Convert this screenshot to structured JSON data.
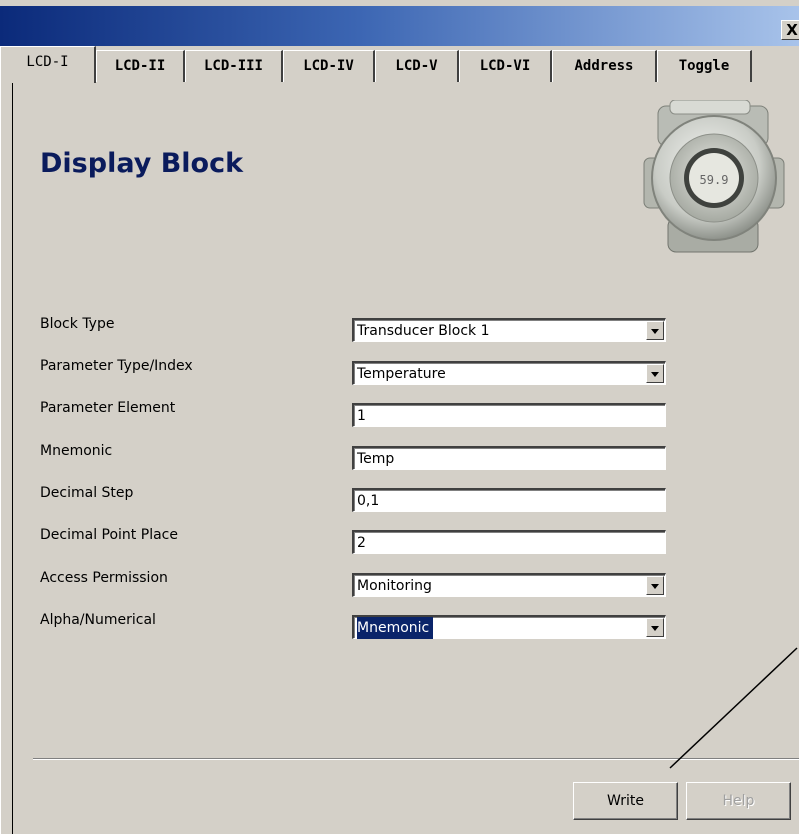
{
  "window": {
    "close_label": "X"
  },
  "tabs": [
    {
      "label": "LCD-I",
      "active": true
    },
    {
      "label": "LCD-II"
    },
    {
      "label": "LCD-III"
    },
    {
      "label": "LCD-IV"
    },
    {
      "label": "LCD-V"
    },
    {
      "label": "LCD-VI"
    },
    {
      "label": "Address"
    },
    {
      "label": "Toggle"
    }
  ],
  "heading": "Display Block",
  "device_image": {
    "display_text": "59.9",
    "icon": "transmitter-housing-icon"
  },
  "fields": {
    "block_type": {
      "label": "Block Type",
      "value": "Transducer Block 1",
      "kind": "dropdown"
    },
    "parameter_type_index": {
      "label": "Parameter Type/Index",
      "value": "Temperature",
      "kind": "dropdown"
    },
    "parameter_element": {
      "label": "Parameter Element",
      "value": "1",
      "kind": "text"
    },
    "mnemonic": {
      "label": "Mnemonic",
      "value": "Temp",
      "kind": "text"
    },
    "decimal_step": {
      "label": "Decimal Step",
      "value": "0,1",
      "kind": "text"
    },
    "decimal_point_place": {
      "label": "Decimal Point Place",
      "value": "2",
      "kind": "text"
    },
    "access_permission": {
      "label": "Access Permission",
      "value": "Monitoring",
      "kind": "dropdown"
    },
    "alpha_numerical": {
      "label": "Alpha/Numerical",
      "value": "Mnemonic",
      "kind": "dropdown",
      "selected": true
    }
  },
  "buttons": {
    "write": "Write",
    "help": "Help"
  },
  "colors": {
    "heading": "#0a1b5c",
    "selection": "#0a246a",
    "face": "#d4d0c8"
  }
}
